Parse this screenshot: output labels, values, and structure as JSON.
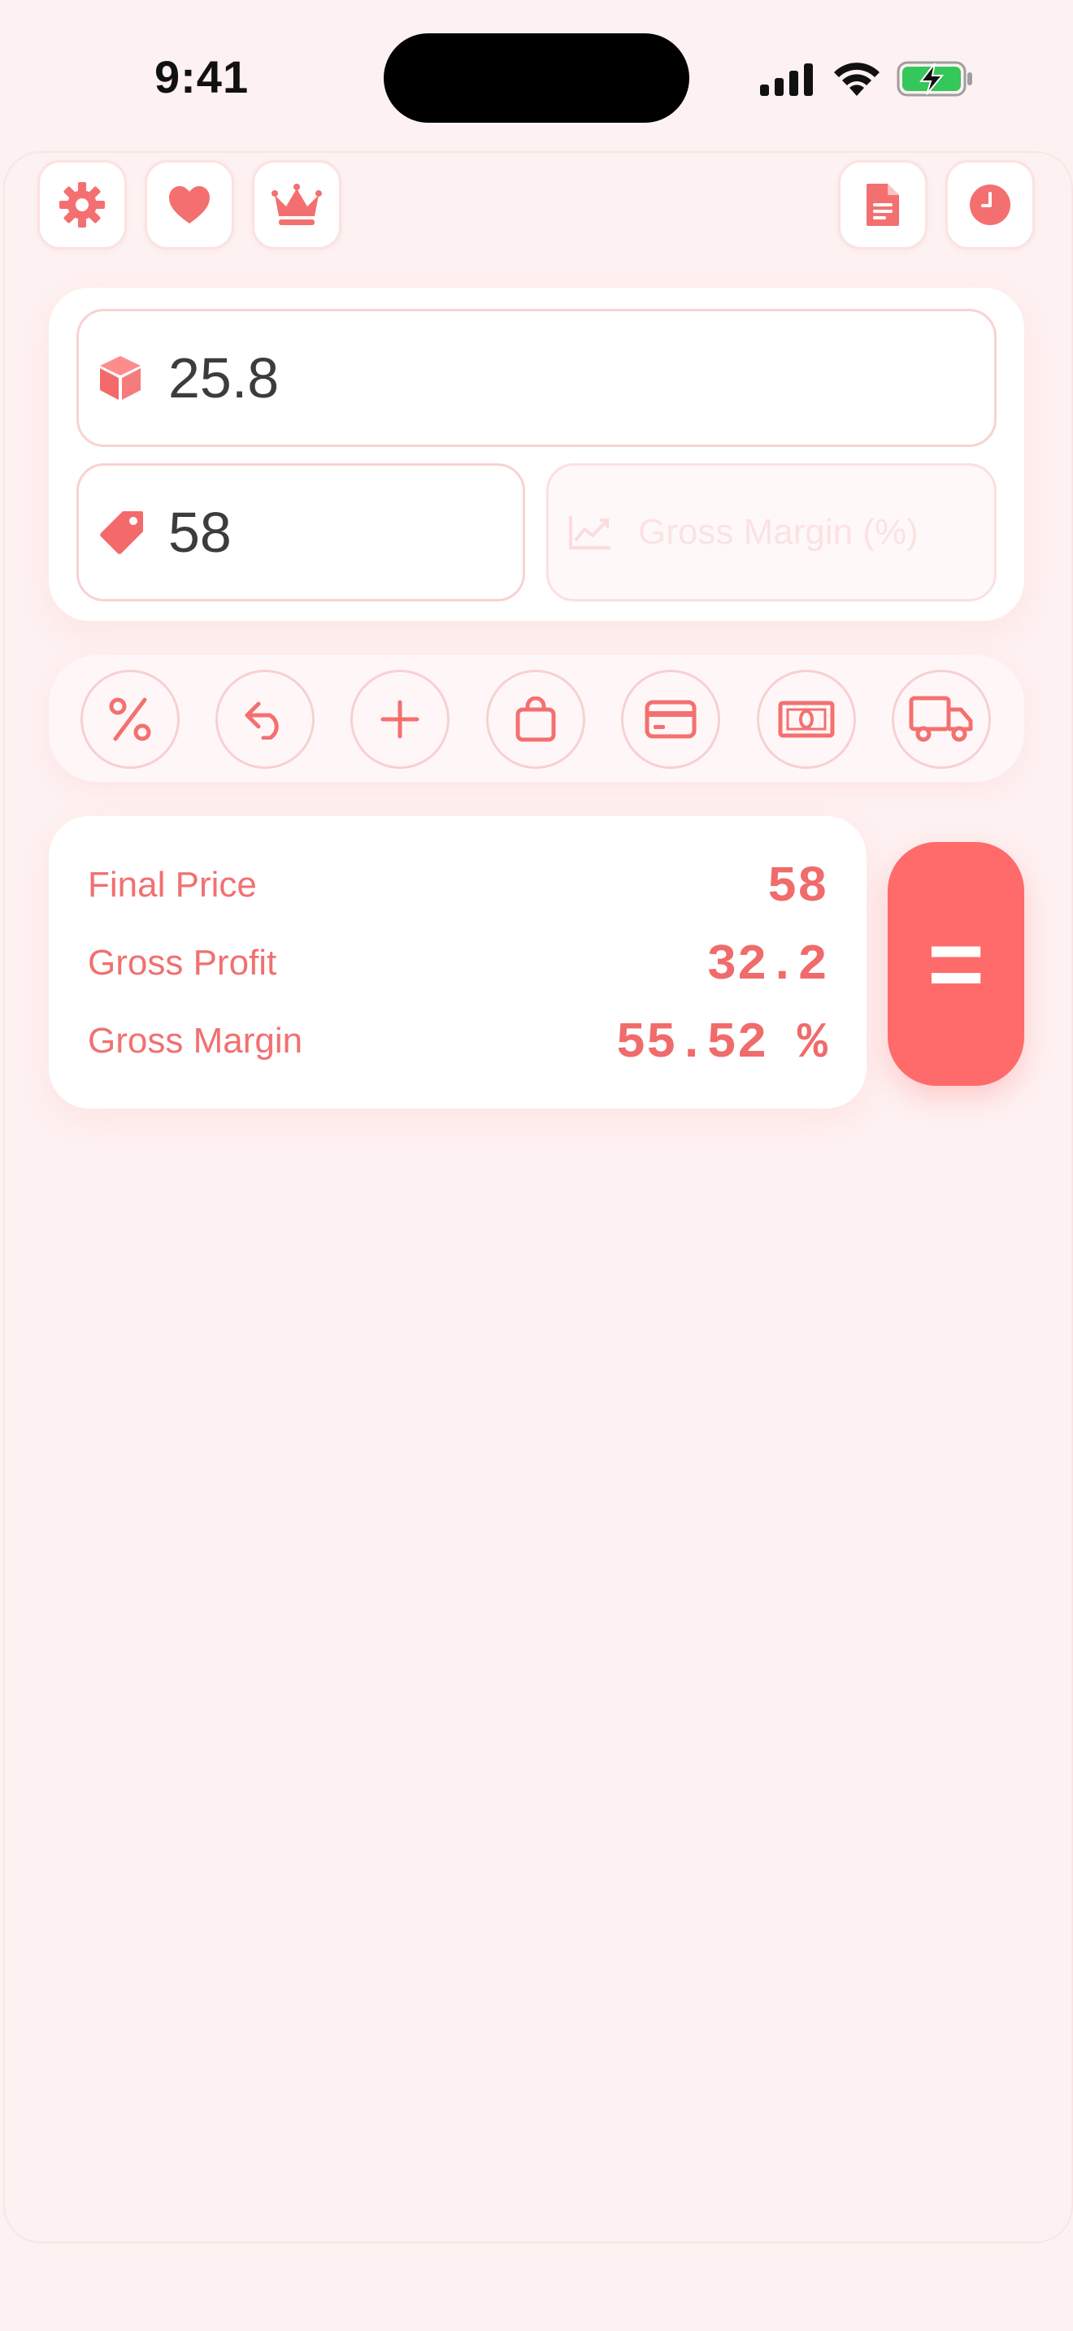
{
  "status_bar": {
    "time": "9:41",
    "icons": [
      "signal-icon",
      "wifi-icon",
      "battery-charging-icon"
    ]
  },
  "toolbar": {
    "left_buttons": [
      "gear-icon",
      "heart-icon",
      "crown-icon"
    ],
    "right_buttons": [
      "document-icon",
      "clock-icon"
    ]
  },
  "inputs": {
    "cost": {
      "value": "25.8",
      "icon": "cube-icon"
    },
    "price": {
      "value": "58",
      "icon": "tag-icon"
    },
    "margin": {
      "value": "",
      "placeholder": "Gross Margin (%)",
      "icon": "chart-line-icon"
    }
  },
  "tools": [
    "percent-icon",
    "undo-icon",
    "plus-icon",
    "shopping-bag-icon",
    "credit-card-icon",
    "cash-icon",
    "truck-icon"
  ],
  "results": {
    "final_price_label": "Final Price",
    "final_price_value": "58",
    "gross_profit_label": "Gross Profit",
    "gross_profit_value": "32.2",
    "gross_margin_label": "Gross Margin",
    "gross_margin_value": "55.52 %"
  },
  "equals_button": {
    "label": "="
  },
  "colors": {
    "accent": "#ff6b6b",
    "text_accent": "#f27070",
    "background": "#fef1f1",
    "border": "#f8d2d2"
  }
}
